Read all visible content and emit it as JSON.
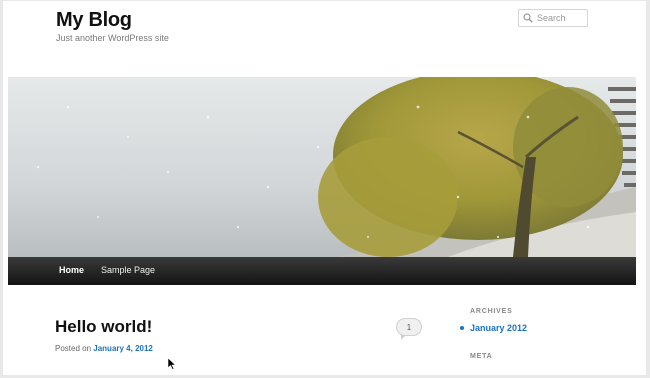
{
  "site": {
    "title": "My Blog",
    "description": "Just another WordPress site"
  },
  "search": {
    "placeholder": "Search"
  },
  "nav": {
    "items": [
      "Home",
      "Sample Page"
    ]
  },
  "post": {
    "title": "Hello world!",
    "posted_prefix": "Posted on",
    "date": "January 4, 2012",
    "comment_count": "1"
  },
  "sidebar": {
    "archives_title": "ARCHIVES",
    "archive_items": [
      "January 2012"
    ],
    "meta_title": "META"
  },
  "colors": {
    "accent": "#1e73be",
    "navbar": "#1f1f1f",
    "title": "#111111"
  },
  "icons": [
    "search-icon",
    "comment-bubble-icon",
    "mouse-pointer-icon"
  ]
}
